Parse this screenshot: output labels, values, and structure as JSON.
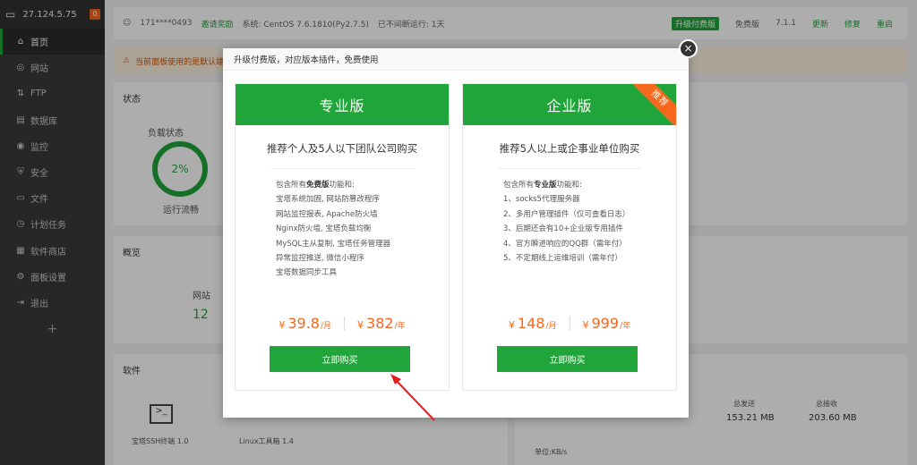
{
  "sidebar": {
    "ip": "27.124.5.75",
    "badge": "0",
    "items": [
      {
        "label": "首页",
        "icon": "home-icon",
        "glyph": "⌂"
      },
      {
        "label": "网站",
        "icon": "globe-icon",
        "glyph": "◎"
      },
      {
        "label": "FTP",
        "icon": "ftp-icon",
        "glyph": "⇅"
      },
      {
        "label": "数据库",
        "icon": "database-icon",
        "glyph": "▤"
      },
      {
        "label": "监控",
        "icon": "monitor-icon",
        "glyph": "◉"
      },
      {
        "label": "安全",
        "icon": "shield-icon",
        "glyph": "⛨"
      },
      {
        "label": "文件",
        "icon": "folder-icon",
        "glyph": "▭"
      },
      {
        "label": "计划任务",
        "icon": "clock-icon",
        "glyph": "◷"
      },
      {
        "label": "软件商店",
        "icon": "store-icon",
        "glyph": "▦"
      },
      {
        "label": "面板设置",
        "icon": "gear-icon",
        "glyph": "⚙"
      },
      {
        "label": "退出",
        "icon": "logout-icon",
        "glyph": "⇥"
      }
    ],
    "add": "+"
  },
  "topbar": {
    "user": "171****0493",
    "bind": "邀请奖励",
    "system": "系统:  CentOS 7.6.1810(Py2.7.5)",
    "uptime": "已不间断运行: 1天",
    "upgrade": "升级付费版",
    "edition": "免费版",
    "version": "7.1.1",
    "update": "更新",
    "repair": "修复",
    "restart": "重启"
  },
  "warning": "当前面板使用的是默认端口[",
  "status": {
    "title": "状态",
    "load_label": "负载状态",
    "load_value": "2%",
    "load_desc": "运行流畅"
  },
  "overview": {
    "title": "概览",
    "site_label": "网站",
    "site_value": "12"
  },
  "software": {
    "title": "软件",
    "items": [
      "宝塔SSH终端 1.0",
      "Linux工具箱 1.4"
    ]
  },
  "traffic": {
    "send_label": "总发送",
    "send_value": "153.21 MB",
    "recv_label": "总接收",
    "recv_value": "203.60 MB",
    "unit": "单位:KB/s"
  },
  "modal": {
    "title": "升级付费版，对应版本插件，免费使用",
    "close": "×",
    "plans": [
      {
        "name": "专业版",
        "ribbon": "",
        "subtitle": "推荐个人及5人以下团队公司购买",
        "intro_pre": "包含所有",
        "intro_bold": "免费版",
        "intro_post": "功能和:",
        "features": [
          "宝塔系统加固, 网站防篡改程序",
          "网站监控报表, Apache防火墙",
          "Nginx防火墙, 宝塔负载均衡",
          "MySQL主从复制, 宝塔任务管理器",
          "异常监控推送, 微信小程序",
          "宝塔数据同步工具"
        ],
        "price1": "39.8",
        "unit1": "/月",
        "price2": "382",
        "unit2": "/年",
        "currency": "¥",
        "buy": "立即购买"
      },
      {
        "name": "企业版",
        "ribbon": "推荐",
        "subtitle": "推荐5人以上或企事业单位购买",
        "intro_pre": "包含所有",
        "intro_bold": "专业版",
        "intro_post": "功能和:",
        "features": [
          "1、socks5代理服务器",
          "2、多用户管理插件（仅可查看日志）",
          "3、后期还会有10+企业版专用插件",
          "4、官方瞬进响应的QQ群（需年付）",
          "5、不定期线上运维培训（需年付）"
        ],
        "price1": "148",
        "unit1": "/月",
        "price2": "999",
        "unit2": "/年",
        "currency": "¥",
        "buy": "立即购买"
      }
    ]
  },
  "colors": {
    "accent": "#20a53a",
    "price": "#f7671d",
    "arrow": "#e02020"
  }
}
